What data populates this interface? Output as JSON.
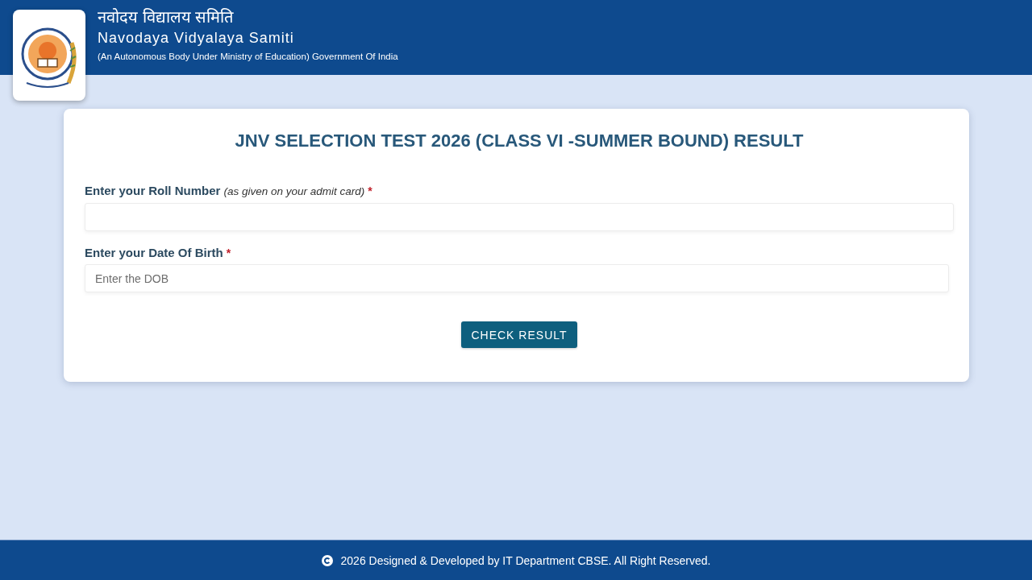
{
  "header": {
    "title_hindi": "नवोदय विद्यालय समिति",
    "title": "Navodaya Vidyalaya Samiti",
    "subtitle": "(An Autonomous Body Under Ministry of Education) Government Of India"
  },
  "form": {
    "title": "JNV SELECTION TEST 2026 (CLASS VI -SUMMER BOUND) RESULT",
    "fields": [
      {
        "label": "Enter your Roll Number *(as given on your admit card)*",
        "required_mark": "*"
      },
      {
        "label": "Enter your Date Of Birth",
        "required_mark": "*",
        "placeholder": "Enter the DOB"
      }
    ],
    "button": "CHECK RESULT"
  },
  "footer": {
    "text": "2026 Designed & Developed by IT Department CBSE. All Right Reserved."
  }
}
